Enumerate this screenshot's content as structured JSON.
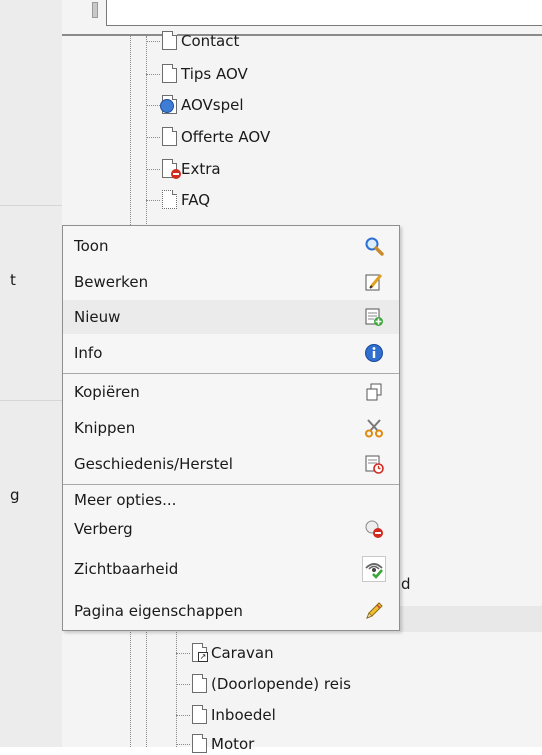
{
  "left_nav": {
    "fragments": [
      "t",
      "g"
    ]
  },
  "tree": {
    "nodes_above": [
      {
        "label": "Contact",
        "icon": "page-icon"
      },
      {
        "label": "Tips AOV",
        "icon": "page-icon"
      },
      {
        "label": "AOVspel",
        "icon": "page-globe-icon"
      },
      {
        "label": "Offerte AOV",
        "icon": "page-icon"
      },
      {
        "label": "Extra",
        "icon": "page-hidden-icon"
      },
      {
        "label": "FAQ",
        "icon": "page-dashed-icon"
      }
    ],
    "partial_label": "d",
    "nodes_below": [
      {
        "label": "Caravan",
        "icon": "page-shortcut-icon"
      },
      {
        "label": "(Doorlopende) reis",
        "icon": "page-icon"
      },
      {
        "label": "Inboedel",
        "icon": "page-icon"
      },
      {
        "label": "Motor",
        "icon": "page-icon"
      }
    ]
  },
  "context_menu": {
    "items": [
      {
        "label": "Toon",
        "icon": "magnifier-icon"
      },
      {
        "label": "Bewerken",
        "icon": "edit-page-icon"
      },
      {
        "label": "Nieuw",
        "icon": "new-page-icon"
      },
      {
        "label": "Info",
        "icon": "info-icon"
      },
      {
        "label": "Kopiëren",
        "icon": "copy-icon"
      },
      {
        "label": "Knippen",
        "icon": "scissors-icon"
      },
      {
        "label": "Geschiedenis/Herstel",
        "icon": "history-icon"
      },
      {
        "label": "Meer opties...",
        "icon": ""
      },
      {
        "label": "Verberg",
        "icon": "hide-icon"
      },
      {
        "label": "Zichtbaarheid",
        "icon": "visibility-icon"
      },
      {
        "label": "Pagina eigenschappen",
        "icon": "pencil-icon"
      }
    ],
    "highlighted_item": "Nieuw"
  },
  "colors": {
    "menu_bg": "#f6f6f6",
    "menu_border": "#8f8f8f",
    "tree_bg": "#f4f4f4",
    "left_bg": "#ececec",
    "accent_blue": "#2f6fd0",
    "accent_red": "#d12a1e",
    "accent_green": "#3aa63a"
  }
}
